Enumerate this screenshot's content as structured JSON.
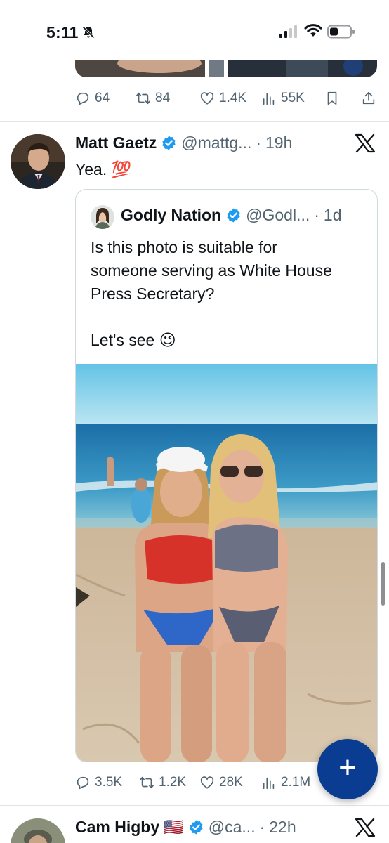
{
  "status_bar": {
    "time": "5:11"
  },
  "previous_tweet": {
    "replies": "64",
    "retweets": "84",
    "likes": "1.4K",
    "views": "55K"
  },
  "tweet": {
    "author_name": "Matt Gaetz",
    "handle": "@mattg...",
    "separator": "·",
    "time": "19h",
    "text": "Yea. 💯",
    "quote": {
      "author_name": "Godly Nation",
      "handle": "@Godl...",
      "separator": "·",
      "time": "1d",
      "text": "Is this photo is suitable for\nsomeone serving as White House\nPress Secretary?\n\nLet's see 😉"
    },
    "replies": "3.5K",
    "retweets": "1.2K",
    "likes": "28K",
    "views": "2.1M"
  },
  "next_tweet": {
    "author_name": "Cam Higby",
    "flag": "🇺🇸",
    "handle": "@ca...",
    "separator": "·",
    "time": "22h"
  },
  "colors": {
    "verified_blue": "#1d9bf0",
    "muted_text": "#536471",
    "fab": "#0a3d91"
  },
  "icons": [
    "bell-slash-icon",
    "signal-icon",
    "wifi-icon",
    "battery-icon",
    "reply-icon",
    "retweet-icon",
    "like-icon",
    "views-icon",
    "bookmark-icon",
    "share-icon",
    "verified-icon",
    "x-logo-icon",
    "compose-plus-icon"
  ]
}
